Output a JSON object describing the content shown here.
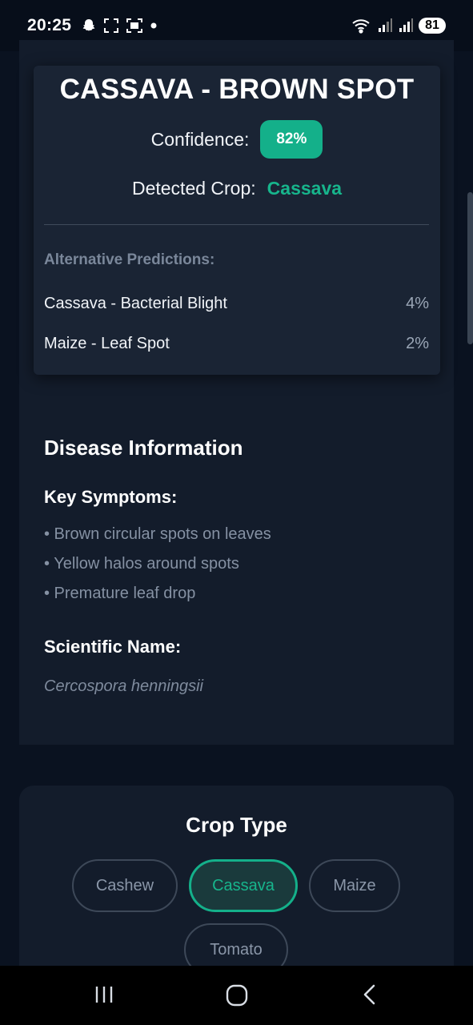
{
  "status_bar": {
    "time": "20:25",
    "battery": "81"
  },
  "prediction": {
    "title": "CASSAVA - BROWN SPOT",
    "confidence_label": "Confidence:",
    "confidence_value": "82%",
    "detected_label": "Detected Crop:",
    "detected_value": "Cassava",
    "alt_title": "Alternative Predictions:",
    "alternatives": [
      {
        "name": "Cassava - Bacterial Blight",
        "pct": "4%"
      },
      {
        "name": "Maize - Leaf Spot",
        "pct": "2%"
      }
    ]
  },
  "disease_info": {
    "title": "Disease Information",
    "symptoms_title": "Key Symptoms:",
    "symptoms": [
      "• Brown circular spots on leaves",
      "• Yellow halos around spots",
      "• Premature leaf drop"
    ],
    "scientific_title": "Scientific Name:",
    "scientific_name": "Cercospora henningsii"
  },
  "crop_type": {
    "title": "Crop Type",
    "options": [
      "Cashew",
      "Cassava",
      "Maize",
      "Tomato"
    ],
    "selected": "Cassava"
  },
  "colors": {
    "accent": "#14b08a",
    "background": "#0a1220",
    "card": "#1a2434"
  }
}
